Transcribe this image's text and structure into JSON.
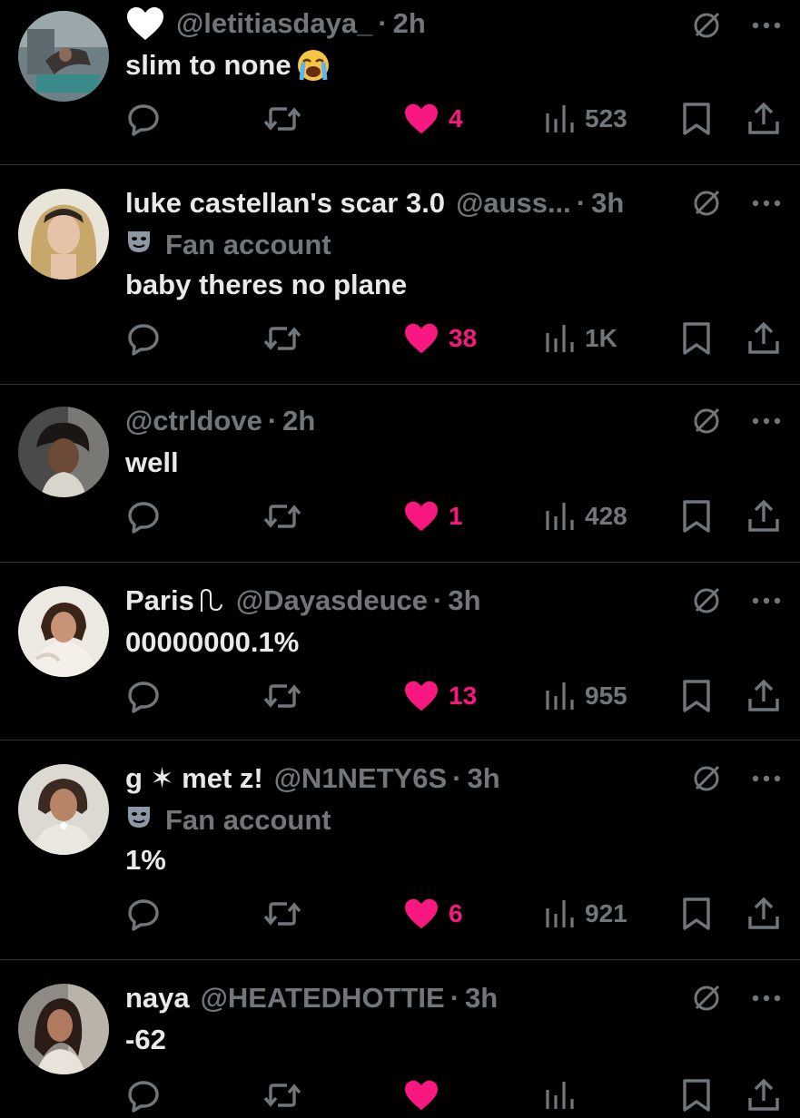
{
  "colors": {
    "background": "#000000",
    "text": "#e7e9ea",
    "muted": "#71767b",
    "like": "#f91880",
    "divider": "#2f3336"
  },
  "tweets": [
    {
      "name": "",
      "handle": "@letitiasdaya_",
      "dot": "·",
      "time": "2h",
      "prefix_icon": "white-heart-icon",
      "badge": "",
      "text": "slim to none",
      "emoji_icon": "loudly-crying-face-icon",
      "likes": "4",
      "views": "523",
      "liked": true
    },
    {
      "name": "luke castellan's scar 3.0",
      "handle": "@auss...",
      "dot": "·",
      "time": "3h",
      "badge": "Fan account",
      "badge_icon": "theater-mask-icon",
      "text": "baby theres no plane",
      "likes": "38",
      "views": "1K",
      "liked": true
    },
    {
      "name": "",
      "handle": "@ctrldove",
      "dot": "·",
      "time": "2h",
      "badge": "",
      "text": "well",
      "likes": "1",
      "views": "428",
      "liked": true
    },
    {
      "name": "Paris",
      "name_icon": "swan-outline-icon",
      "handle": "@Dayasdeuce",
      "dot": "·",
      "time": "3h",
      "badge": "",
      "text": "00000000.1%",
      "likes": "13",
      "views": "955",
      "liked": true
    },
    {
      "name": "g ✶ met z!",
      "handle": "@N1NETY6S",
      "dot": "·",
      "time": "3h",
      "badge": "Fan account",
      "badge_icon": "theater-mask-icon",
      "text": "1%",
      "likes": "6",
      "views": "921",
      "liked": true
    },
    {
      "name": "naya",
      "handle": "@HEATEDHOTTIE",
      "dot": "·",
      "time": "3h",
      "badge": "",
      "text": "-62",
      "likes": "",
      "views": "",
      "liked": true
    }
  ]
}
